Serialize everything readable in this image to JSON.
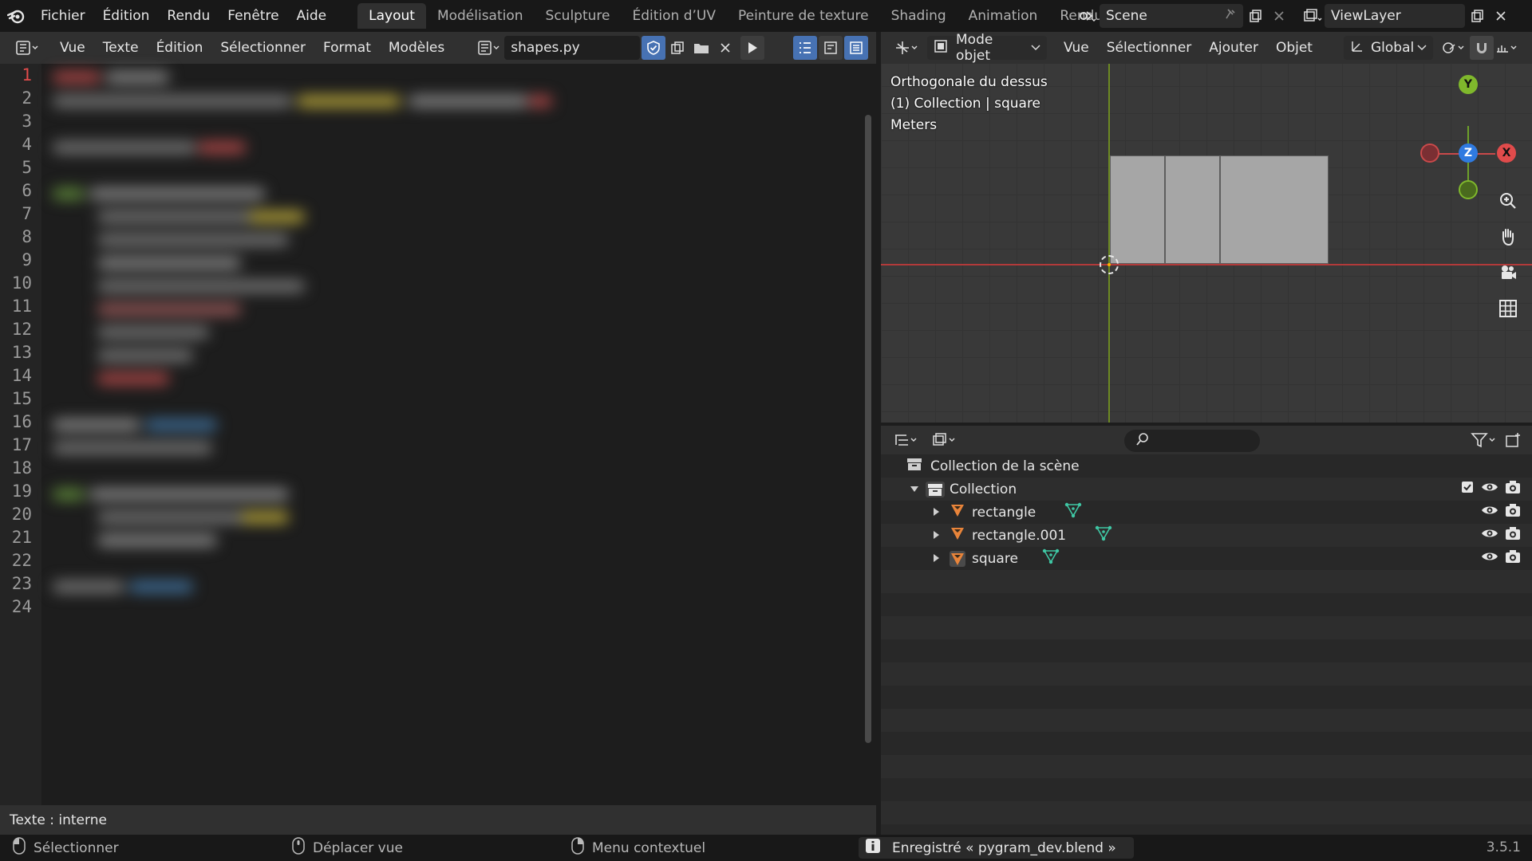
{
  "app": {
    "menu": [
      "Fichier",
      "Édition",
      "Rendu",
      "Fenêtre",
      "Aide"
    ],
    "workspaces": [
      {
        "label": "Layout",
        "active": true
      },
      {
        "label": "Modélisation"
      },
      {
        "label": "Sculpture"
      },
      {
        "label": "Édition d’UV"
      },
      {
        "label": "Peinture de texture"
      },
      {
        "label": "Shading"
      },
      {
        "label": "Animation"
      },
      {
        "label": "Rendu"
      }
    ],
    "scene": "Scene",
    "view_layer": "ViewLayer"
  },
  "text_editor": {
    "menus": [
      "Vue",
      "Texte",
      "Édition",
      "Sélectionner",
      "Format",
      "Modèles"
    ],
    "filename": "shapes.py",
    "line_numbers": [
      "1",
      "2",
      "3",
      "4",
      "5",
      "6",
      "7",
      "8",
      "9",
      "10",
      "11",
      "12",
      "13",
      "14",
      "15",
      "16",
      "17",
      "18",
      "19",
      "20",
      "21",
      "22",
      "23",
      "24"
    ],
    "current_line": 1,
    "footer": "Texte : interne"
  },
  "viewport": {
    "mode": "Mode objet",
    "menus": [
      "Vue",
      "Sélectionner",
      "Ajouter",
      "Objet"
    ],
    "orientation": "Global",
    "overlay_lines": [
      "Orthogonale du dessus",
      "(1) Collection | square",
      "Meters"
    ],
    "gizmo": {
      "y": "Y",
      "z": "Z",
      "x": "X"
    },
    "colors": {
      "x_axis": "#b23a3a",
      "y_axis": "#6d8a23",
      "z_axis": "#2f7ae0"
    }
  },
  "outliner": {
    "scene_collection": "Collection de la scène",
    "collection": "Collection",
    "objects": [
      "rectangle",
      "rectangle.001",
      "square"
    ]
  },
  "status": {
    "select": "Sélectionner",
    "move_view": "Déplacer vue",
    "context_menu": "Menu contextuel",
    "report": "Enregistré « pygram_dev.blend »",
    "version": "3.5.1"
  }
}
